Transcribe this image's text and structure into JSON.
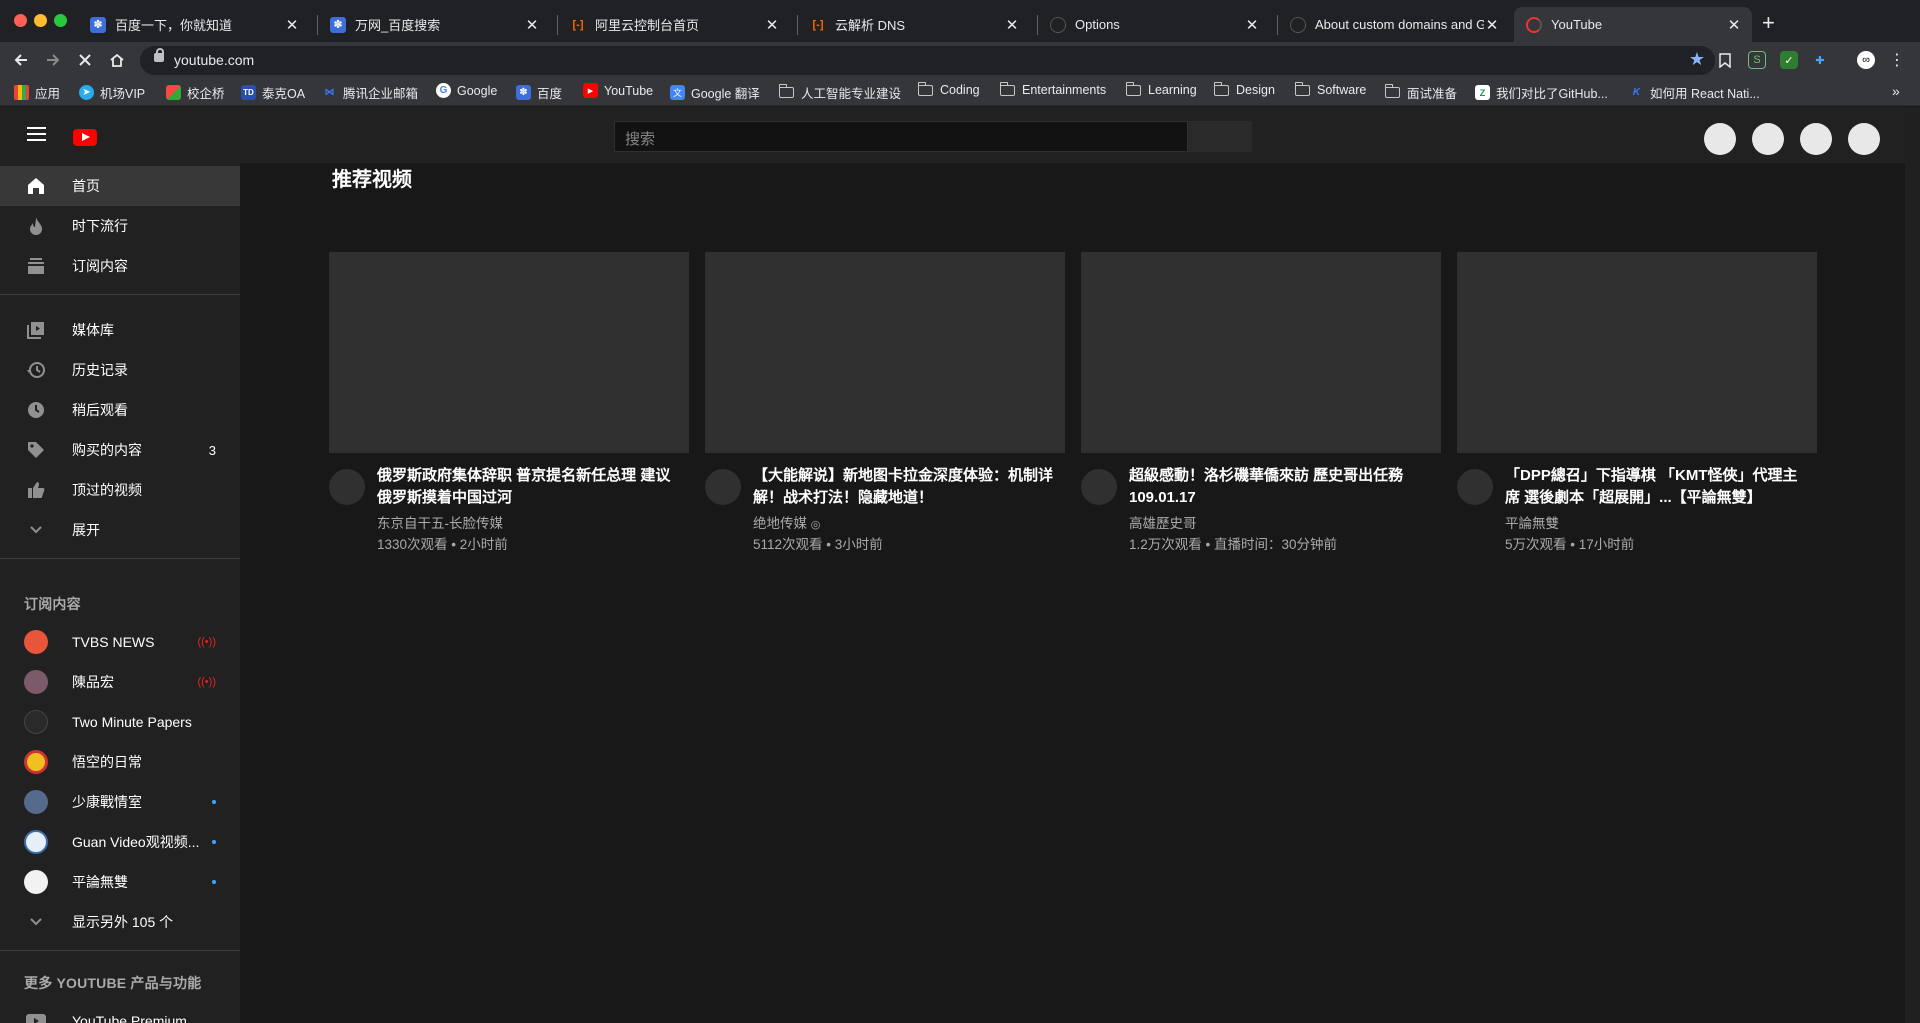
{
  "browser": {
    "tabs": [
      {
        "title": "百度一下，你就知道"
      },
      {
        "title": "万网_百度搜索"
      },
      {
        "title": "阿里云控制台首页"
      },
      {
        "title": "云解析 DNS"
      },
      {
        "title": "Options"
      },
      {
        "title": "About custom domains and Gi"
      },
      {
        "title": "YouTube"
      }
    ],
    "url": "youtube.com",
    "bookmarks": [
      {
        "label": "应用"
      },
      {
        "label": "机场VIP"
      },
      {
        "label": "校企桥"
      },
      {
        "label": "泰克OA"
      },
      {
        "label": "腾讯企业邮箱"
      },
      {
        "label": "Google"
      },
      {
        "label": "百度"
      },
      {
        "label": "YouTube"
      },
      {
        "label": "Google 翻译"
      },
      {
        "label": "人工智能专业建设"
      },
      {
        "label": "Coding"
      },
      {
        "label": "Entertainments"
      },
      {
        "label": "Learning"
      },
      {
        "label": "Design"
      },
      {
        "label": "Software"
      },
      {
        "label": "面试准备"
      },
      {
        "label": "我们对比了GitHub..."
      },
      {
        "label": "如何用 React Nati..."
      }
    ]
  },
  "youtube": {
    "search_placeholder": "搜索",
    "nav": [
      {
        "label": "首页"
      },
      {
        "label": "时下流行"
      },
      {
        "label": "订阅内容"
      }
    ],
    "library": [
      {
        "label": "媒体库"
      },
      {
        "label": "历史记录"
      },
      {
        "label": "稍后观看"
      },
      {
        "label": "购买的内容",
        "count": "3"
      },
      {
        "label": "顶过的视频"
      },
      {
        "label": "展开"
      }
    ],
    "subscriptions_heading": "订阅内容",
    "subscriptions": [
      {
        "name": "TVBS NEWS",
        "status": "live"
      },
      {
        "name": "陳品宏",
        "status": "live"
      },
      {
        "name": "Two Minute Papers",
        "status": ""
      },
      {
        "name": "悟空的日常",
        "status": ""
      },
      {
        "name": "少康戰情室",
        "status": "new"
      },
      {
        "name": "Guan Video观视频...",
        "status": "new"
      },
      {
        "name": "平論無雙",
        "status": "new"
      }
    ],
    "show_more": "显示另外 105 个",
    "more_heading": "更多 YOUTUBE 产品与功能",
    "premium": "YouTube Premium",
    "section_title": "推荐视频",
    "videos": [
      {
        "title": "俄罗斯政府集体辞职 普京提名新任总理 建议俄罗斯摸着中国过河",
        "channel": "东京自干五-长脸传媒",
        "meta": "1330次观看 • 2小时前"
      },
      {
        "title": "【大能解说】新地图卡拉金深度体验：机制详解！战术打法！隐藏地道！",
        "channel": "绝地传媒",
        "meta": "5112次观看 • 3小时前"
      },
      {
        "title": "超級感動！洛杉磯華僑來訪 歷史哥出任務 109.01.17",
        "channel": "高雄歷史哥",
        "meta": "1.2万次观看 • 直播时间：30分钟前"
      },
      {
        "title": "「DPP總召」下指導棋 「KMT怪俠」代理主席 選後劇本「超展開」...【平論無雙】",
        "channel": "平論無雙",
        "meta": "5万次观看 • 17小时前"
      }
    ]
  }
}
